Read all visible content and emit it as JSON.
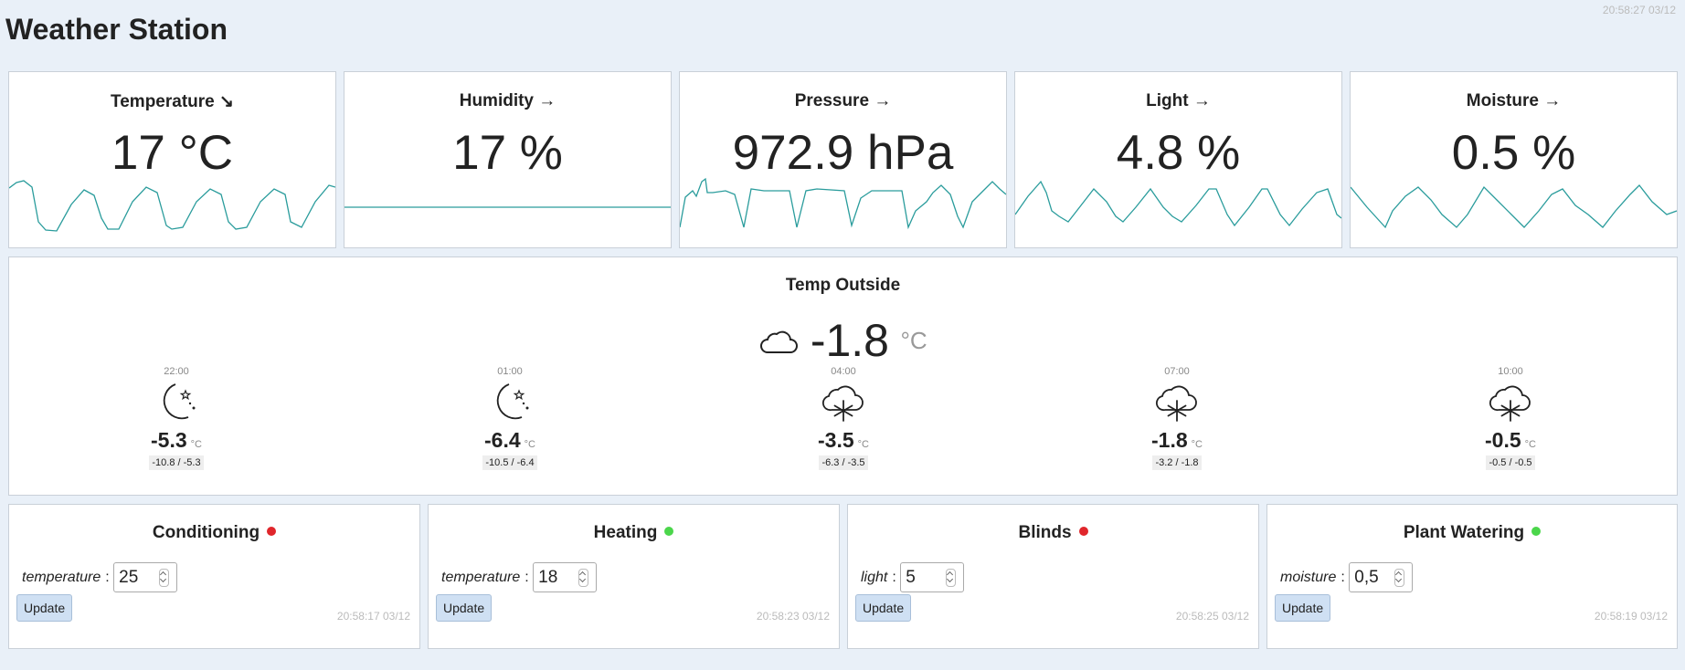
{
  "header": {
    "title": "Weather Station",
    "clock": "20:58:27 03/12"
  },
  "sensors": [
    {
      "title": "Temperature",
      "trend": "↘",
      "value": "17 °C"
    },
    {
      "title": "Humidity",
      "trend": "→",
      "value": "17 %"
    },
    {
      "title": "Pressure",
      "trend": "→",
      "value": "972.9 hPa"
    },
    {
      "title": "Light",
      "trend": "→",
      "value": "4.8 %"
    },
    {
      "title": "Moisture",
      "trend": "→",
      "value": "0.5 %"
    }
  ],
  "sparkline_color": "#2a9c9c",
  "outside": {
    "title": "Temp Outside",
    "icon": "cloud-icon",
    "temp": "-1.8",
    "unit": "°C",
    "forecast": [
      {
        "time": "22:00",
        "icon": "moon-stars-icon",
        "temp": "-5.3",
        "unit": "°C",
        "range": "-10.8 / -5.3"
      },
      {
        "time": "01:00",
        "icon": "moon-stars-icon",
        "temp": "-6.4",
        "unit": "°C",
        "range": "-10.5 / -6.4"
      },
      {
        "time": "04:00",
        "icon": "snow-cloud-icon",
        "temp": "-3.5",
        "unit": "°C",
        "range": "-6.3 / -3.5"
      },
      {
        "time": "07:00",
        "icon": "snow-cloud-icon",
        "temp": "-1.8",
        "unit": "°C",
        "range": "-3.2 / -1.8"
      },
      {
        "time": "10:00",
        "icon": "snow-cloud-icon",
        "temp": "-0.5",
        "unit": "°C",
        "range": "-0.5 / -0.5"
      }
    ]
  },
  "devices": [
    {
      "title": "Conditioning",
      "status": "off",
      "status_color": "#e0262b",
      "param_label": "temperature",
      "value": "25",
      "button": "Update",
      "time": "20:58:17 03/12"
    },
    {
      "title": "Heating",
      "status": "on",
      "status_color": "#4bd64b",
      "param_label": "temperature",
      "value": "18",
      "button": "Update",
      "time": "20:58:23 03/12"
    },
    {
      "title": "Blinds",
      "status": "off",
      "status_color": "#e0262b",
      "param_label": "light",
      "value": "5",
      "button": "Update",
      "time": "20:58:25 03/12"
    },
    {
      "title": "Plant Watering",
      "status": "on",
      "status_color": "#4bd64b",
      "param_label": "moisture",
      "value": "0,5",
      "button": "Update",
      "time": "20:58:19 03/12"
    }
  ]
}
